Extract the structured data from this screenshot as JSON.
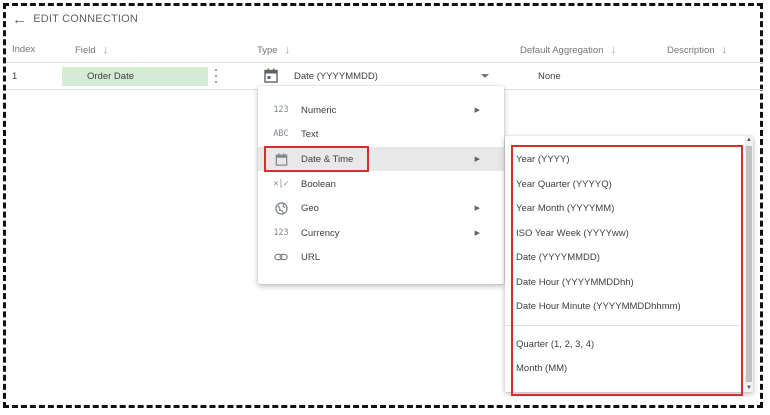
{
  "header": {
    "back_icon": "arrow-left-icon",
    "title": "EDIT CONNECTION"
  },
  "columns": {
    "index": "Index",
    "field": "Field",
    "type": "Type",
    "aggregation": "Default Aggregation",
    "description": "Description"
  },
  "row": {
    "index": "1",
    "field": "Order Date",
    "type": "Date (YYYYMMDD)",
    "aggregation": "None",
    "field_color": "#d5ebd3"
  },
  "type_menu": {
    "items": [
      {
        "icon": "123",
        "label": "Numeric",
        "has_submenu": true
      },
      {
        "icon": "ABC",
        "label": "Text",
        "has_submenu": false
      },
      {
        "icon": "calendar-icon",
        "label": "Date & Time",
        "has_submenu": true,
        "highlighted": true
      },
      {
        "icon": "×|✓",
        "label": "Boolean",
        "has_submenu": false
      },
      {
        "icon": "globe-icon",
        "label": "Geo",
        "has_submenu": true
      },
      {
        "icon": "123",
        "label": "Currency",
        "has_submenu": true
      },
      {
        "icon": "link-icon",
        "label": "URL",
        "has_submenu": false
      }
    ]
  },
  "date_submenu": {
    "items": [
      "Year (YYYY)",
      "Year Quarter (YYYYQ)",
      "Year Month (YYYYMM)",
      "ISO Year Week (YYYYww)",
      "Date (YYYYMMDD)",
      "Date Hour (YYYYMMDDhh)",
      "Date Hour Minute (YYYYMMDDhhmm)",
      "Quarter (1, 2, 3, 4)",
      "Month (MM)"
    ]
  },
  "colors": {
    "highlight_border": "#d32f2f",
    "frame": "#111111"
  }
}
